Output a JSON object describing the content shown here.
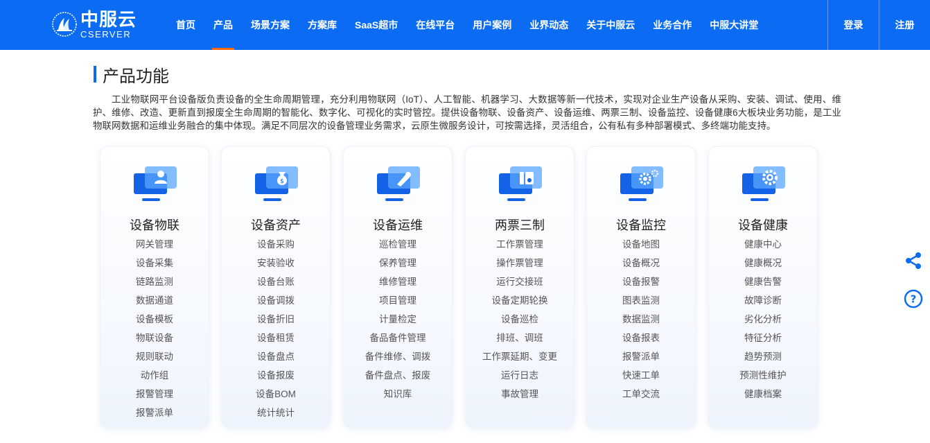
{
  "logo": {
    "cn": "中服云",
    "en": "CSERVER"
  },
  "nav": [
    {
      "label": "首页"
    },
    {
      "label": "产品",
      "active": true
    },
    {
      "label": "场景方案"
    },
    {
      "label": "方案库"
    },
    {
      "label": "SaaS超市"
    },
    {
      "label": "在线平台"
    },
    {
      "label": "用户案例"
    },
    {
      "label": "业界动态"
    },
    {
      "label": "关于中服云"
    },
    {
      "label": "业务合作"
    },
    {
      "label": "中服大讲堂"
    }
  ],
  "auth": {
    "login": "登录",
    "register": "注册"
  },
  "section": {
    "title": "产品功能",
    "intro": "工业物联网平台设备版负责设备的全生命周期管理，充分利用物联网（IoT）、人工智能、机器学习、大数据等新一代技术，实现对企业生产设备从采购、安装、调试、使用、维护、维修、改造、更新直到报废全生命周期的智能化、数字化、可视化的实时管控。提供设备物联、设备资产、设备运维、两票三制、设备监控、设备健康6大板块业务功能，是工业物联网数据和运维业务融合的集中体现。满足不同层次的设备管理业务需求，云原生微服务设计，可按需选择，灵活组合，公有私有多种部署模式、多终端功能支持。"
  },
  "colors": {
    "brand": "#0b6cf3",
    "active_underline": "#ff6a00"
  },
  "cards": [
    {
      "icon": "user-monitor-icon",
      "title": "设备物联",
      "items": [
        "网关管理",
        "设备采集",
        "链路监测",
        "数据通道",
        "设备模板",
        "物联设备",
        "规则联动",
        "动作组",
        "报警管理",
        "报警派单"
      ]
    },
    {
      "icon": "money-bag-monitor-icon",
      "title": "设备资产",
      "items": [
        "设备采购",
        "安装验收",
        "设备台账",
        "设备调拨",
        "设备折旧",
        "设备租赁",
        "设备盘点",
        "设备报废",
        "设备BOM",
        "统计统计"
      ]
    },
    {
      "icon": "wrench-monitor-icon",
      "title": "设备运维",
      "items": [
        "巡检管理",
        "保养管理",
        "维修管理",
        "项目管理",
        "计量检定",
        "备品备件管理",
        "备件维修、调拨",
        "备件盘点、报废",
        "知识库"
      ]
    },
    {
      "icon": "ticket-monitor-icon",
      "title": "两票三制",
      "items": [
        "工作票管理",
        "操作票管理",
        "运行交接班",
        "设备定期轮换",
        "设备巡检",
        "排班、调班",
        "工作票延期、变更",
        "运行日志",
        "事故管理"
      ]
    },
    {
      "icon": "gears-monitor-icon",
      "title": "设备监控",
      "items": [
        "设备地图",
        "设备概况",
        "设备报警",
        "图表监测",
        "数据监测",
        "设备报表",
        "报警派单",
        "快速工单",
        "工单交流"
      ]
    },
    {
      "icon": "gear-monitor-icon",
      "title": "设备健康",
      "items": [
        "健康中心",
        "健康概况",
        "健康告警",
        "故障诊断",
        "劣化分析",
        "特征分析",
        "趋势预测",
        "预测性维护",
        "健康档案"
      ]
    }
  ]
}
